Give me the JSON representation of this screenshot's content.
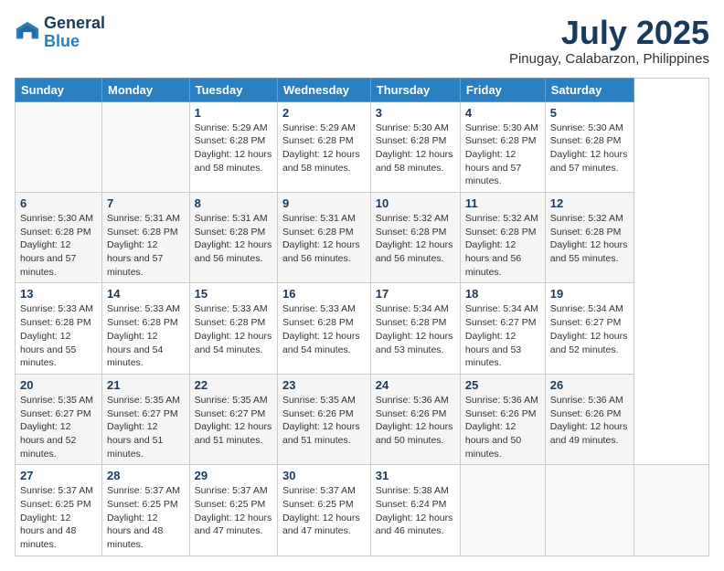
{
  "header": {
    "logo_general": "General",
    "logo_blue": "Blue",
    "month_title": "July 2025",
    "location": "Pinugay, Calabarzon, Philippines"
  },
  "weekdays": [
    "Sunday",
    "Monday",
    "Tuesday",
    "Wednesday",
    "Thursday",
    "Friday",
    "Saturday"
  ],
  "days": [
    {
      "date": "",
      "info": ""
    },
    {
      "date": "",
      "info": ""
    },
    {
      "date": "1",
      "sunrise": "5:29 AM",
      "sunset": "6:28 PM",
      "daylight": "12 hours and 58 minutes."
    },
    {
      "date": "2",
      "sunrise": "5:29 AM",
      "sunset": "6:28 PM",
      "daylight": "12 hours and 58 minutes."
    },
    {
      "date": "3",
      "sunrise": "5:30 AM",
      "sunset": "6:28 PM",
      "daylight": "12 hours and 58 minutes."
    },
    {
      "date": "4",
      "sunrise": "5:30 AM",
      "sunset": "6:28 PM",
      "daylight": "12 hours and 57 minutes."
    },
    {
      "date": "5",
      "sunrise": "5:30 AM",
      "sunset": "6:28 PM",
      "daylight": "12 hours and 57 minutes."
    },
    {
      "date": "6",
      "sunrise": "5:30 AM",
      "sunset": "6:28 PM",
      "daylight": "12 hours and 57 minutes."
    },
    {
      "date": "7",
      "sunrise": "5:31 AM",
      "sunset": "6:28 PM",
      "daylight": "12 hours and 57 minutes."
    },
    {
      "date": "8",
      "sunrise": "5:31 AM",
      "sunset": "6:28 PM",
      "daylight": "12 hours and 56 minutes."
    },
    {
      "date": "9",
      "sunrise": "5:31 AM",
      "sunset": "6:28 PM",
      "daylight": "12 hours and 56 minutes."
    },
    {
      "date": "10",
      "sunrise": "5:32 AM",
      "sunset": "6:28 PM",
      "daylight": "12 hours and 56 minutes."
    },
    {
      "date": "11",
      "sunrise": "5:32 AM",
      "sunset": "6:28 PM",
      "daylight": "12 hours and 56 minutes."
    },
    {
      "date": "12",
      "sunrise": "5:32 AM",
      "sunset": "6:28 PM",
      "daylight": "12 hours and 55 minutes."
    },
    {
      "date": "13",
      "sunrise": "5:33 AM",
      "sunset": "6:28 PM",
      "daylight": "12 hours and 55 minutes."
    },
    {
      "date": "14",
      "sunrise": "5:33 AM",
      "sunset": "6:28 PM",
      "daylight": "12 hours and 54 minutes."
    },
    {
      "date": "15",
      "sunrise": "5:33 AM",
      "sunset": "6:28 PM",
      "daylight": "12 hours and 54 minutes."
    },
    {
      "date": "16",
      "sunrise": "5:33 AM",
      "sunset": "6:28 PM",
      "daylight": "12 hours and 54 minutes."
    },
    {
      "date": "17",
      "sunrise": "5:34 AM",
      "sunset": "6:28 PM",
      "daylight": "12 hours and 53 minutes."
    },
    {
      "date": "18",
      "sunrise": "5:34 AM",
      "sunset": "6:27 PM",
      "daylight": "12 hours and 53 minutes."
    },
    {
      "date": "19",
      "sunrise": "5:34 AM",
      "sunset": "6:27 PM",
      "daylight": "12 hours and 52 minutes."
    },
    {
      "date": "20",
      "sunrise": "5:35 AM",
      "sunset": "6:27 PM",
      "daylight": "12 hours and 52 minutes."
    },
    {
      "date": "21",
      "sunrise": "5:35 AM",
      "sunset": "6:27 PM",
      "daylight": "12 hours and 51 minutes."
    },
    {
      "date": "22",
      "sunrise": "5:35 AM",
      "sunset": "6:27 PM",
      "daylight": "12 hours and 51 minutes."
    },
    {
      "date": "23",
      "sunrise": "5:35 AM",
      "sunset": "6:26 PM",
      "daylight": "12 hours and 51 minutes."
    },
    {
      "date": "24",
      "sunrise": "5:36 AM",
      "sunset": "6:26 PM",
      "daylight": "12 hours and 50 minutes."
    },
    {
      "date": "25",
      "sunrise": "5:36 AM",
      "sunset": "6:26 PM",
      "daylight": "12 hours and 50 minutes."
    },
    {
      "date": "26",
      "sunrise": "5:36 AM",
      "sunset": "6:26 PM",
      "daylight": "12 hours and 49 minutes."
    },
    {
      "date": "27",
      "sunrise": "5:37 AM",
      "sunset": "6:25 PM",
      "daylight": "12 hours and 48 minutes."
    },
    {
      "date": "28",
      "sunrise": "5:37 AM",
      "sunset": "6:25 PM",
      "daylight": "12 hours and 48 minutes."
    },
    {
      "date": "29",
      "sunrise": "5:37 AM",
      "sunset": "6:25 PM",
      "daylight": "12 hours and 47 minutes."
    },
    {
      "date": "30",
      "sunrise": "5:37 AM",
      "sunset": "6:25 PM",
      "daylight": "12 hours and 47 minutes."
    },
    {
      "date": "31",
      "sunrise": "5:38 AM",
      "sunset": "6:24 PM",
      "daylight": "12 hours and 46 minutes."
    },
    {
      "date": "",
      "info": ""
    },
    {
      "date": "",
      "info": ""
    },
    {
      "date": "",
      "info": ""
    },
    {
      "date": "",
      "info": ""
    },
    {
      "date": "",
      "info": ""
    }
  ],
  "labels": {
    "sunrise": "Sunrise: ",
    "sunset": "Sunset: ",
    "daylight": "Daylight: "
  }
}
